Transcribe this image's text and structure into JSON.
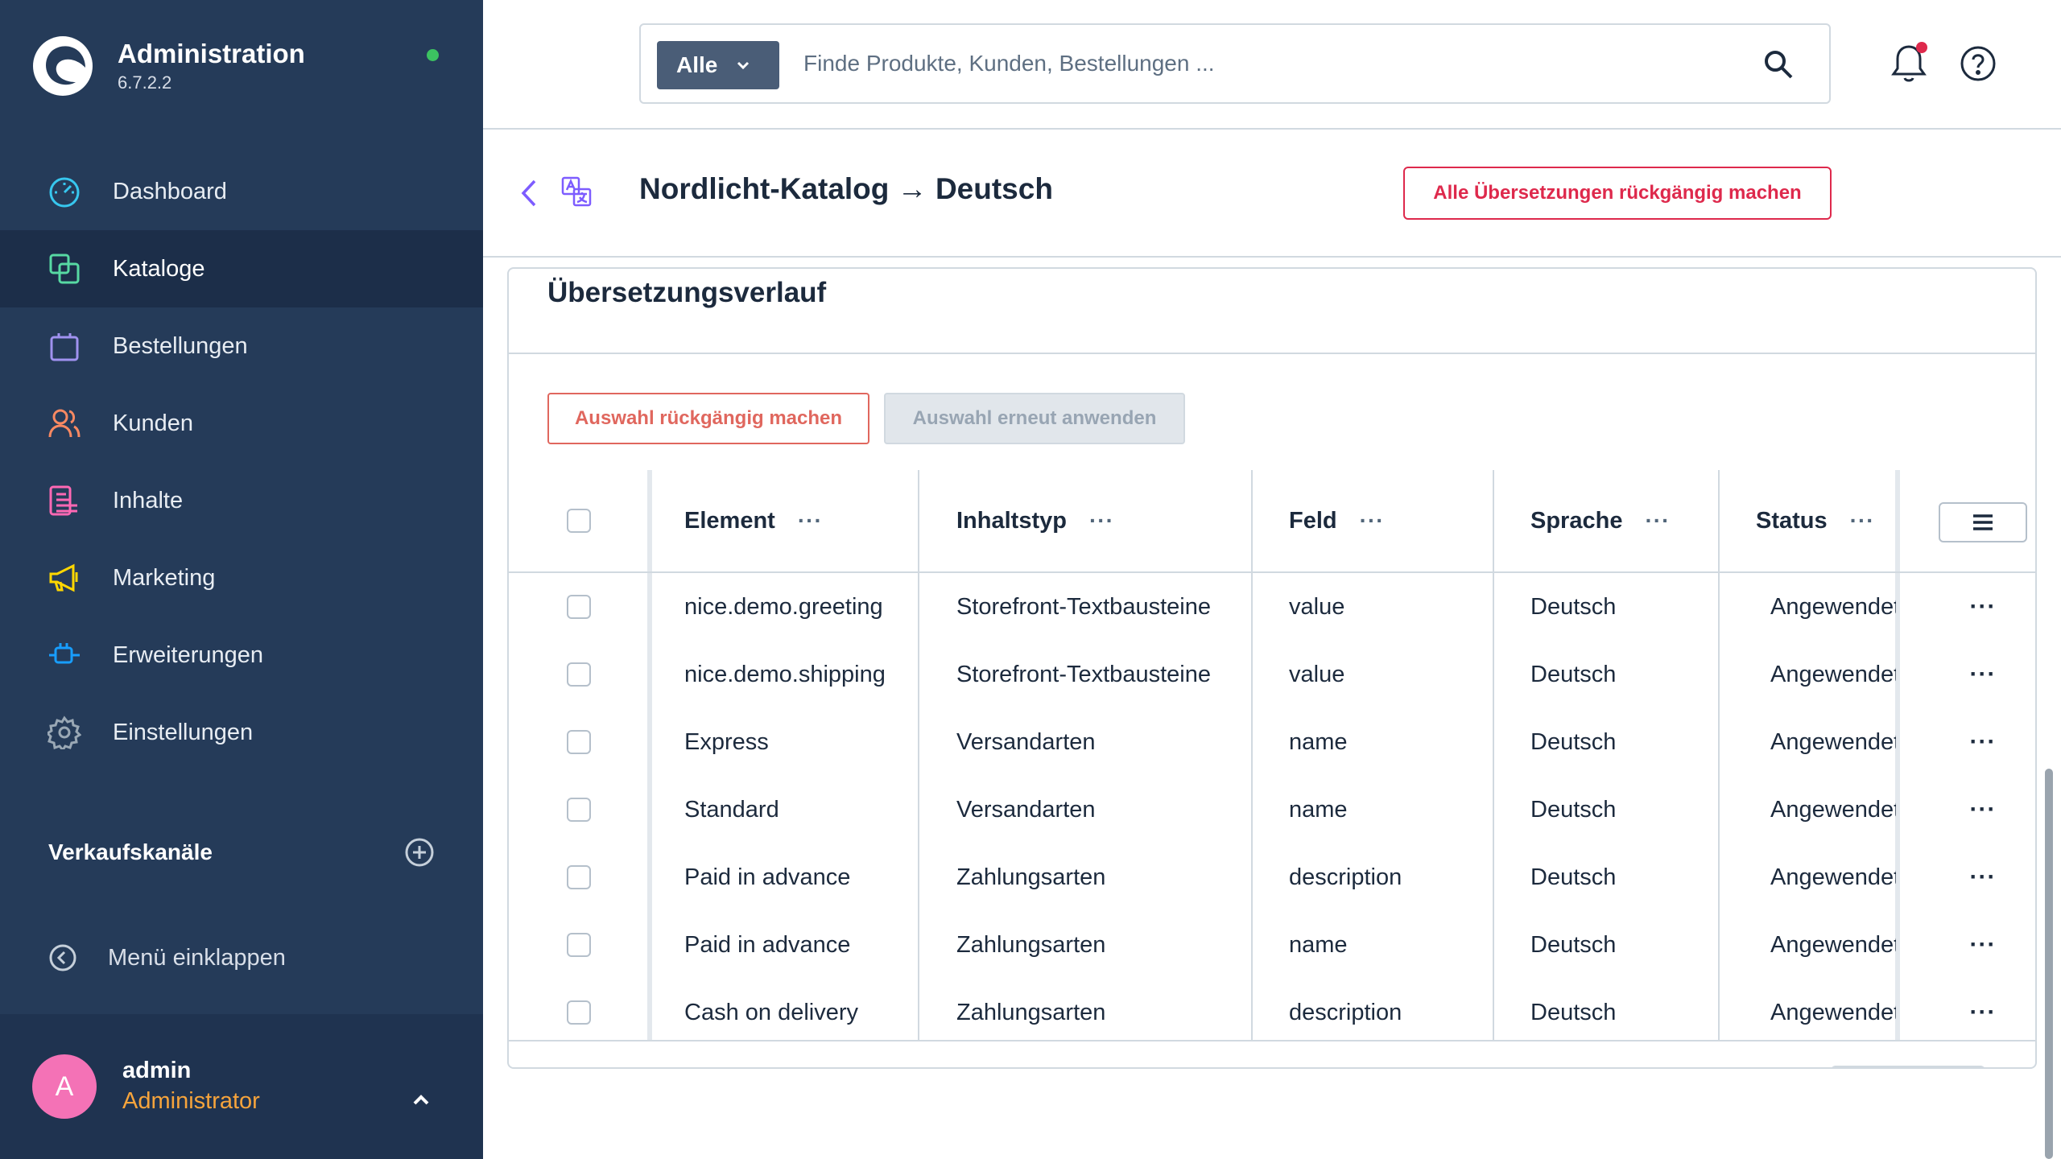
{
  "app": {
    "title": "Administration",
    "version": "6.7.2.2",
    "online_color": "#3cc261"
  },
  "sidebar": {
    "items": [
      {
        "label": "Dashboard",
        "icon": "dashboard-icon",
        "color": "#37c7ef",
        "active": false
      },
      {
        "label": "Kataloge",
        "icon": "catalog-icon",
        "color": "#57d9a3",
        "active": true
      },
      {
        "label": "Bestellungen",
        "icon": "orders-icon",
        "color": "#a092f0",
        "active": false
      },
      {
        "label": "Kunden",
        "icon": "customers-icon",
        "color": "#f88962",
        "active": false
      },
      {
        "label": "Inhalte",
        "icon": "content-icon",
        "color": "#ff68b4",
        "active": false
      },
      {
        "label": "Marketing",
        "icon": "marketing-icon",
        "color": "#ffd700",
        "active": false
      },
      {
        "label": "Erweiterungen",
        "icon": "extensions-icon",
        "color": "#189eff",
        "active": false
      },
      {
        "label": "Einstellungen",
        "icon": "settings-icon",
        "color": "#9aa8b5",
        "active": false
      }
    ],
    "sales_channels_label": "Verkaufskanäle",
    "collapse_label": "Menü einklappen",
    "user": {
      "initial": "A",
      "name": "admin",
      "role": "Administrator"
    }
  },
  "search": {
    "scope": "Alle",
    "placeholder": "Finde Produkte, Kunden, Bestellungen ..."
  },
  "header": {
    "title": "Nordlicht-Katalog → Deutsch",
    "revert_all_label": "Alle Übersetzungen rückgängig machen"
  },
  "card": {
    "title": "Übersetzungsverlauf",
    "undo_label": "Auswahl rückgängig machen",
    "reapply_label": "Auswahl erneut anwenden",
    "columns": [
      "Element",
      "Inhaltstyp",
      "Feld",
      "Sprache",
      "Status"
    ],
    "column_menu": "···",
    "rows": [
      {
        "element": "nice.demo.greeting",
        "type": "Storefront-Textbausteine",
        "field": "value",
        "language": "Deutsch",
        "status": "Angewendet"
      },
      {
        "element": "nice.demo.shipping",
        "type": "Storefront-Textbausteine",
        "field": "value",
        "language": "Deutsch",
        "status": "Angewendet"
      },
      {
        "element": "Express",
        "type": "Versandarten",
        "field": "name",
        "language": "Deutsch",
        "status": "Angewendet"
      },
      {
        "element": "Standard",
        "type": "Versandarten",
        "field": "name",
        "language": "Deutsch",
        "status": "Angewendet"
      },
      {
        "element": "Paid in advance",
        "type": "Zahlungsarten",
        "field": "description",
        "language": "Deutsch",
        "status": "Angewendet"
      },
      {
        "element": "Paid in advance",
        "type": "Zahlungsarten",
        "field": "name",
        "language": "Deutsch",
        "status": "Angewendet"
      },
      {
        "element": "Cash on delivery",
        "type": "Zahlungsarten",
        "field": "description",
        "language": "Deutsch",
        "status": "Angewendet"
      }
    ]
  },
  "colors": {
    "danger": "#de294c",
    "sidebar_bg": "#253b59",
    "status_ok": "#3cc261"
  }
}
